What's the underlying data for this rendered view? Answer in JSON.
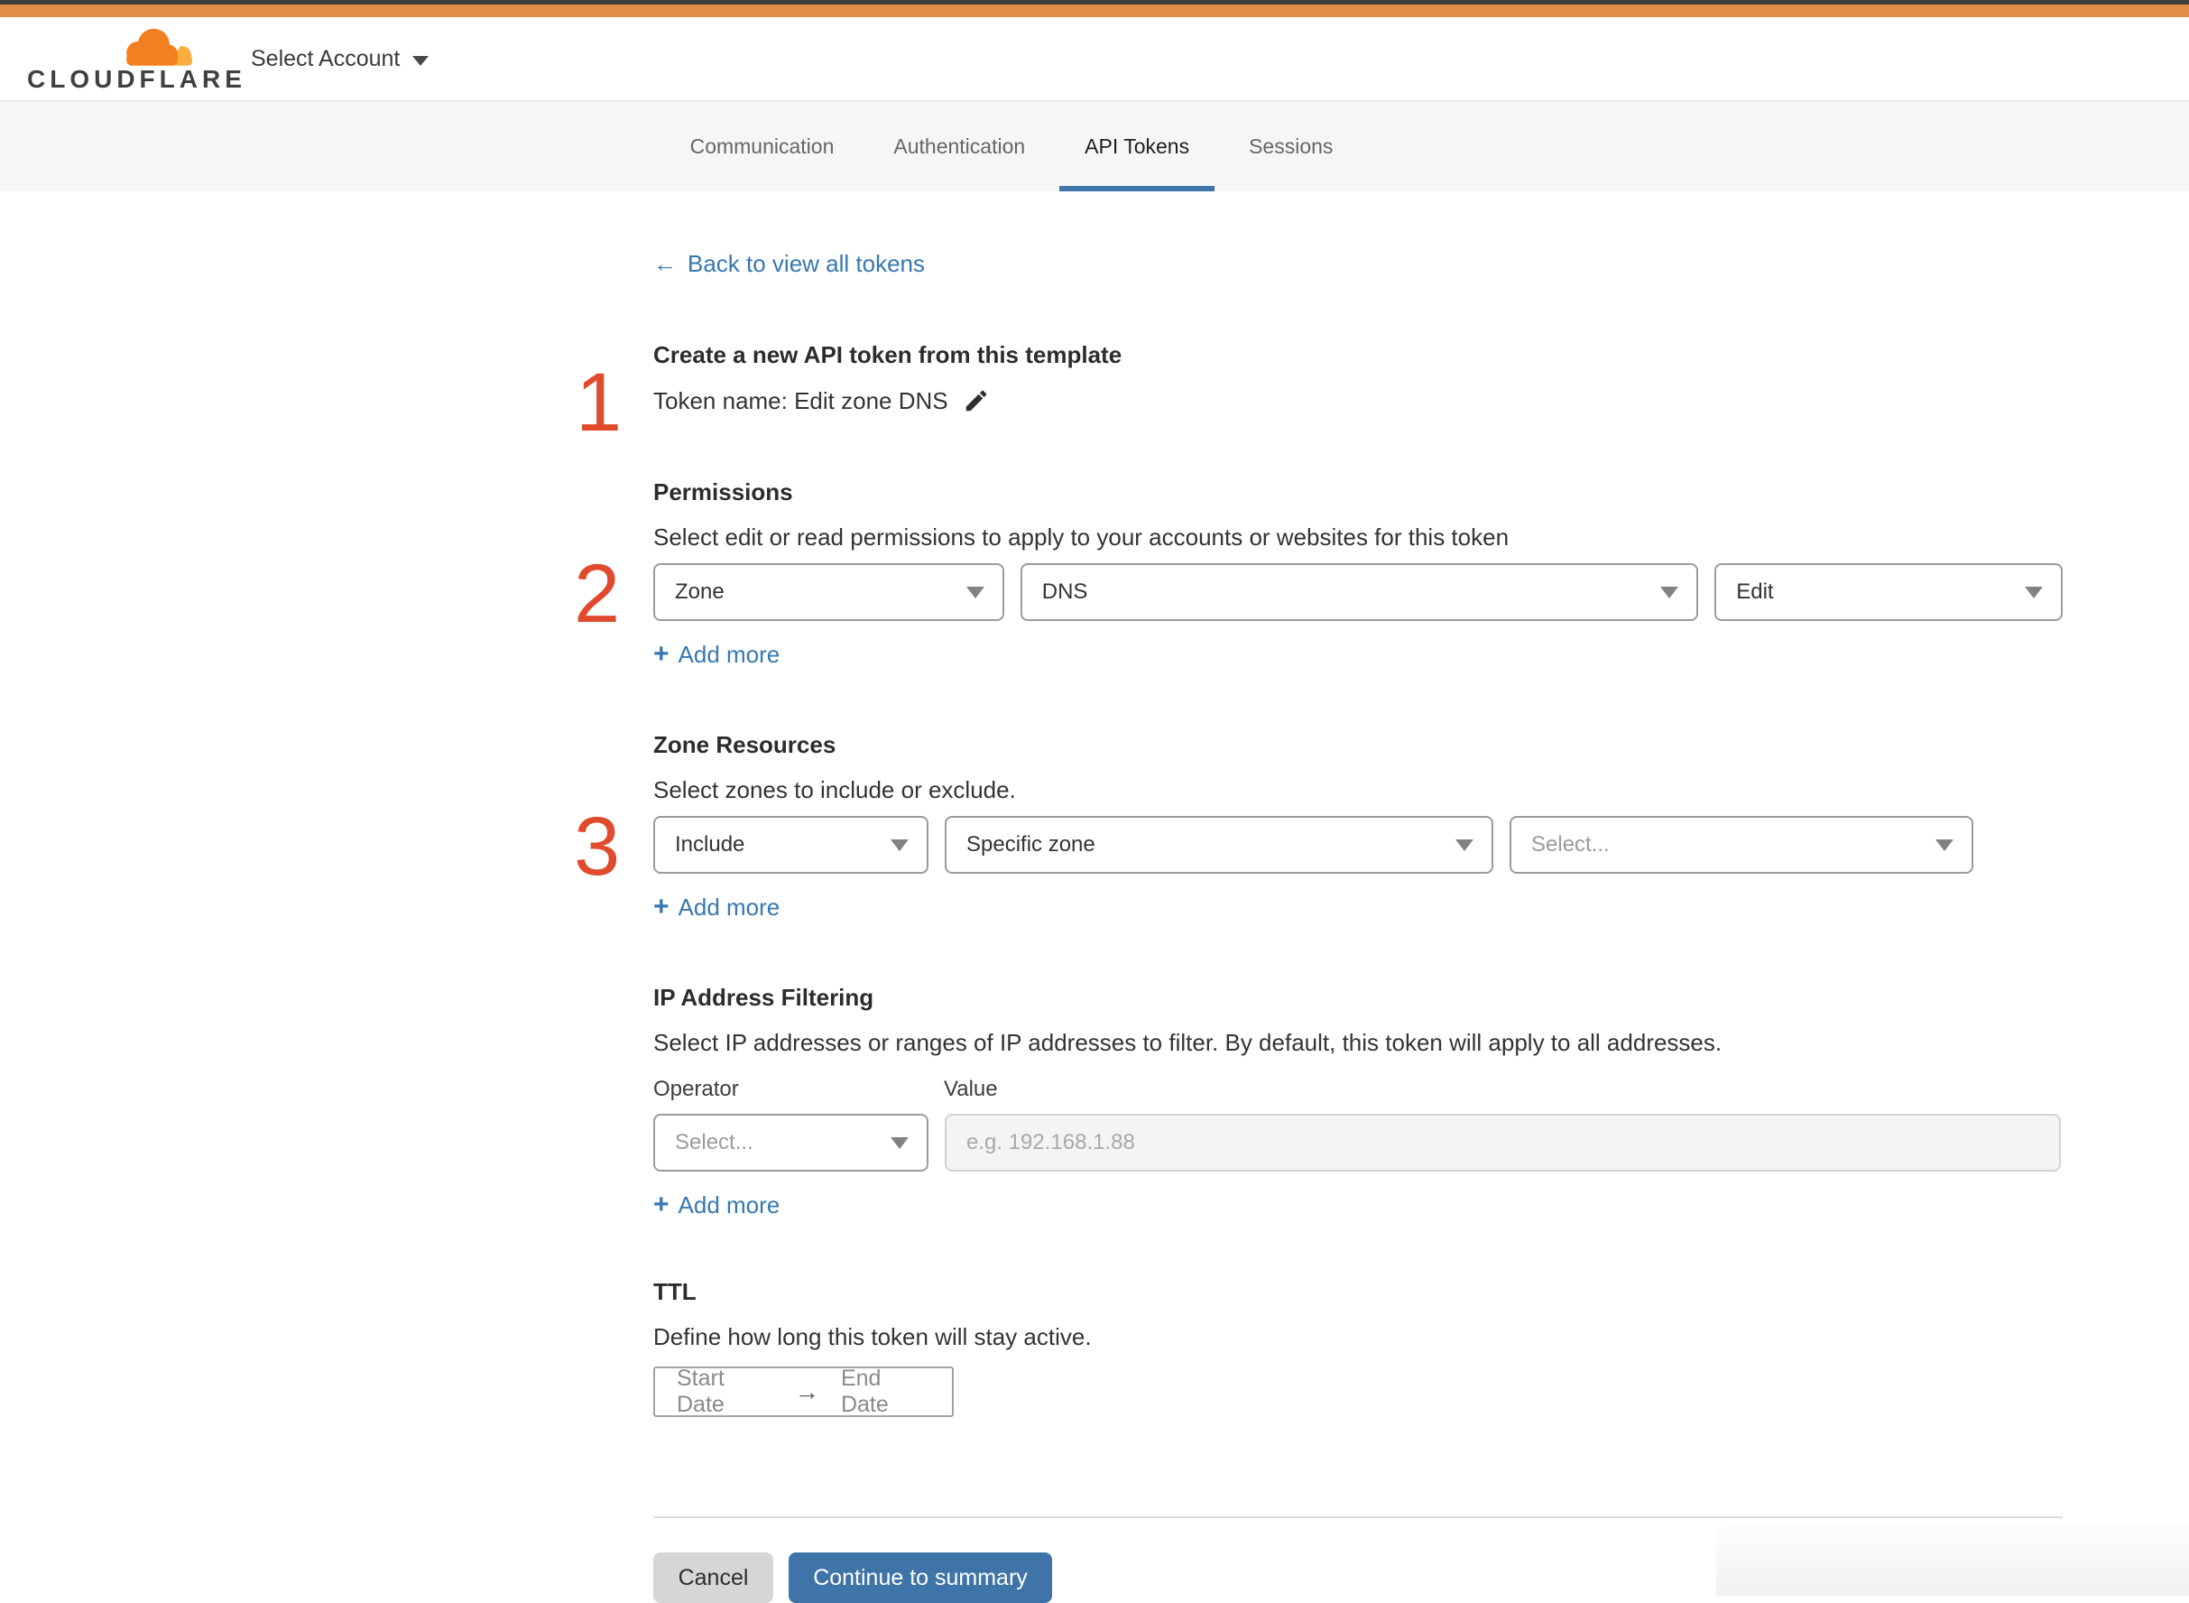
{
  "colors": {
    "top_bar_orange": "#E18F47",
    "logo_orange": "#F38020",
    "logo_light_orange": "#FAAE40",
    "link_blue": "#3678B0",
    "active_tab_blue": "#3E74A8",
    "primary_button_blue": "#3E74A8",
    "step_number_red": "#E04B2E"
  },
  "header": {
    "brand": "CLOUDFLARE",
    "account_selector": "Select Account"
  },
  "tabs": [
    {
      "label": "Communication",
      "active": false
    },
    {
      "label": "Authentication",
      "active": false
    },
    {
      "label": "API Tokens",
      "active": true
    },
    {
      "label": "Sessions",
      "active": false
    }
  ],
  "page": {
    "back_link": {
      "arrow": "←",
      "label": "Back to view all tokens"
    },
    "create_section": {
      "step": "1",
      "title": "Create a new API token from this template",
      "token_name": "Token name: Edit zone DNS"
    },
    "permissions": {
      "step": "2",
      "title": "Permissions",
      "description": "Select edit or read permissions to apply to your accounts or websites for this token",
      "scope_value": "Zone",
      "resource_value": "DNS",
      "access_value": "Edit",
      "add_more": {
        "plus": "+",
        "label": "Add more"
      }
    },
    "zone_resources": {
      "step": "3",
      "title": "Zone Resources",
      "description": "Select zones to include or exclude.",
      "mode_value": "Include",
      "type_value": "Specific zone",
      "zone_placeholder": "Select...",
      "add_more": {
        "plus": "+",
        "label": "Add more"
      }
    },
    "ip_filtering": {
      "title": "IP Address Filtering",
      "description": "Select IP addresses or ranges of IP addresses to filter. By default, this token will apply to all addresses.",
      "operator_label": "Operator",
      "value_label": "Value",
      "operator_placeholder": "Select...",
      "value_placeholder": "e.g. 192.168.1.88",
      "add_more": {
        "plus": "+",
        "label": "Add more"
      }
    },
    "ttl": {
      "title": "TTL",
      "description": "Define how long this token will stay active.",
      "start_date": "Start Date",
      "arrow": "→",
      "end_date": "End Date"
    },
    "footer": {
      "cancel": "Cancel",
      "continue": "Continue to summary"
    }
  }
}
